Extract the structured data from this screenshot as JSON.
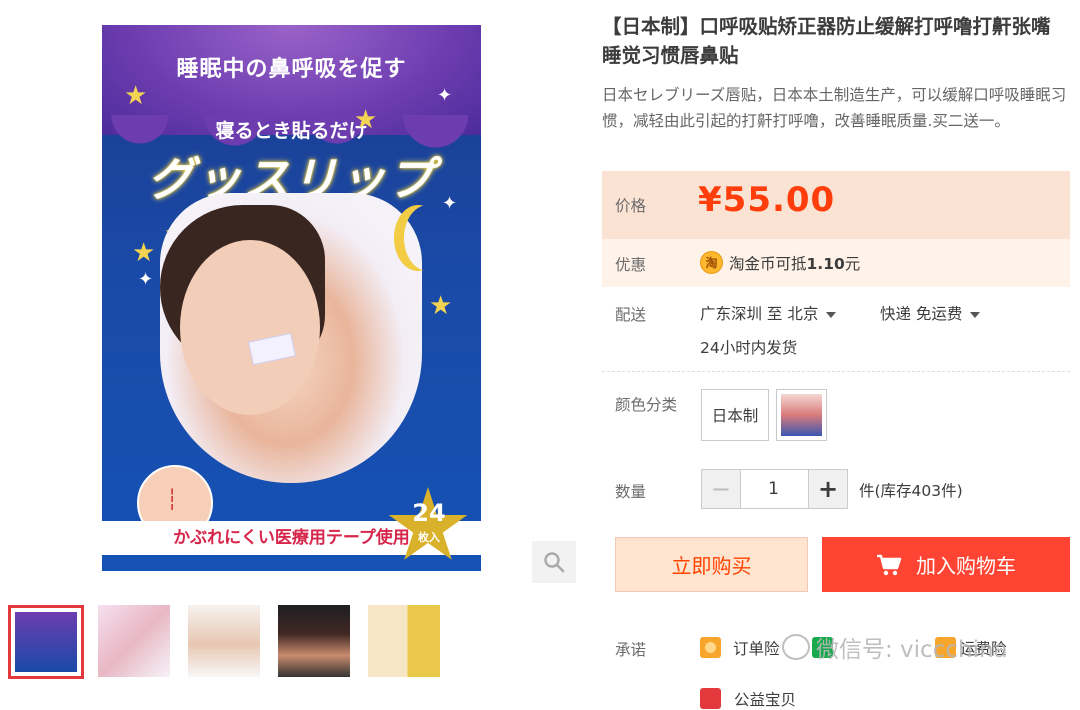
{
  "product": {
    "title": "【日本制】口呼吸贴矫正器防止缓解打呼噜打鼾张嘴睡觉习惯唇鼻贴",
    "subtitle": "日本セレブリーズ唇贴，日本本土制造生产，可以缓解口呼吸睡眠习惯，减轻由此引起的打鼾打呼噜，改善睡眠质量.买二送一。"
  },
  "gallery": {
    "main_image": {
      "top_text": "睡眠中の鼻呼吸を促す",
      "sub_text": "寝るとき貼るだけ",
      "brand": "グッスリップ",
      "bottom_text": "かぶれにくい医療用テープ使用",
      "count": "24",
      "count_unit": "枚入"
    },
    "thumbnail_count": 5,
    "active_thumbnail": 1
  },
  "price": {
    "label": "价格",
    "value": "¥55.00"
  },
  "promo": {
    "label": "优惠",
    "coin_glyph": "淘",
    "text": "淘金币可抵",
    "amount": "1.10",
    "unit": "元"
  },
  "shipping": {
    "label": "配送",
    "route": "广东深圳 至  北京",
    "method": "快递 免运费",
    "time": "24小时内发货"
  },
  "color": {
    "label": "颜色分类",
    "options": [
      "日本制"
    ]
  },
  "quantity": {
    "label": "数量",
    "minus": "−",
    "value": "1",
    "plus": "+",
    "stock": "件(库存403件)"
  },
  "actions": {
    "buy_now": "立即购买",
    "add_cart": "加入购物车"
  },
  "commitments": {
    "label": "承诺",
    "items": [
      "订单险",
      "",
      "运费险",
      "公益宝贝"
    ]
  },
  "watermark": "微信号: viccchina",
  "colors": {
    "price_red": "#ff3e0c",
    "cart_button": "#ff4433",
    "price_bg": "#fbe3d4",
    "active_border": "#e4393c"
  }
}
